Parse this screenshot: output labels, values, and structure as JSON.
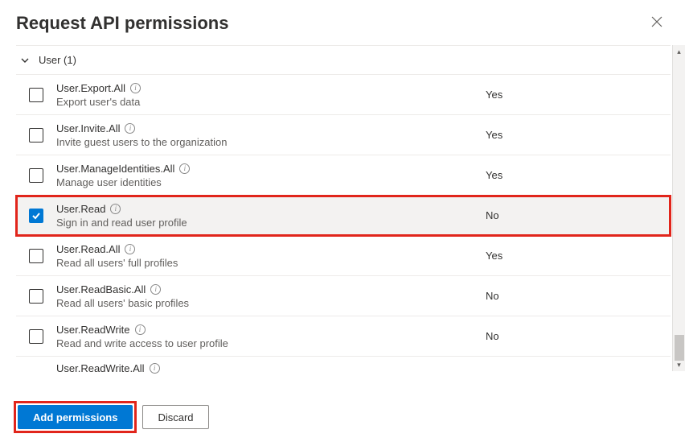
{
  "header": {
    "title": "Request API permissions"
  },
  "group": {
    "label": "User (1)"
  },
  "permissions": [
    {
      "name": "User.Export.All",
      "desc": "Export user's data",
      "admin": "Yes",
      "checked": false
    },
    {
      "name": "User.Invite.All",
      "desc": "Invite guest users to the organization",
      "admin": "Yes",
      "checked": false
    },
    {
      "name": "User.ManageIdentities.All",
      "desc": "Manage user identities",
      "admin": "Yes",
      "checked": false
    },
    {
      "name": "User.Read",
      "desc": "Sign in and read user profile",
      "admin": "No",
      "checked": true,
      "highlighted": true
    },
    {
      "name": "User.Read.All",
      "desc": "Read all users' full profiles",
      "admin": "Yes",
      "checked": false
    },
    {
      "name": "User.ReadBasic.All",
      "desc": "Read all users' basic profiles",
      "admin": "No",
      "checked": false
    },
    {
      "name": "User.ReadWrite",
      "desc": "Read and write access to user profile",
      "admin": "No",
      "checked": false
    },
    {
      "name": "User.ReadWrite.All",
      "desc": "",
      "admin": "",
      "checked": false,
      "partial": true
    }
  ],
  "footer": {
    "primary_label": "Add permissions",
    "secondary_label": "Discard"
  }
}
